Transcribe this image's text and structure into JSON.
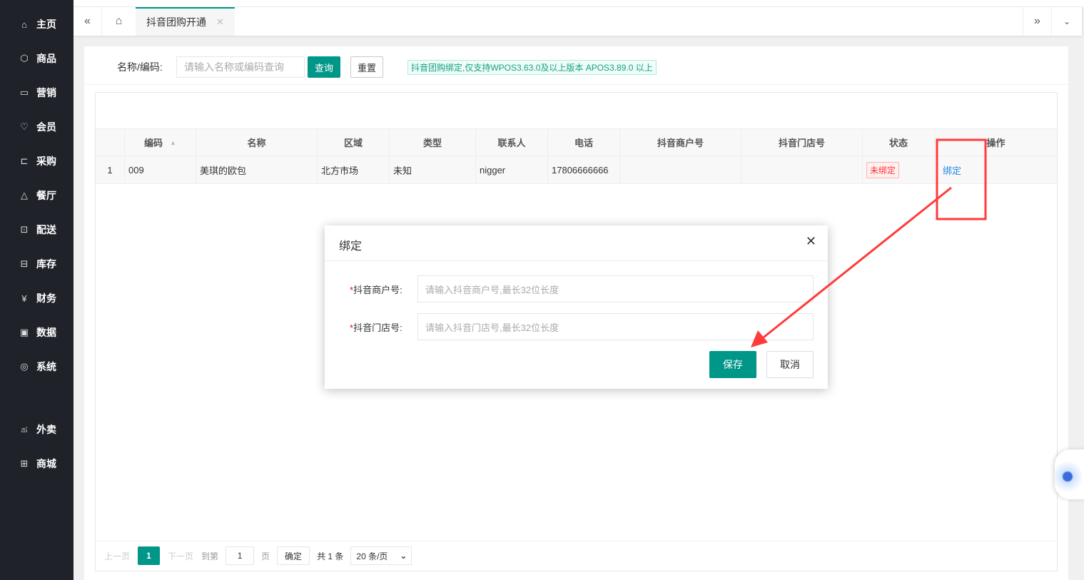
{
  "sidebar": {
    "items": [
      {
        "label": "主页",
        "icon": "home-icon"
      },
      {
        "label": "商品",
        "icon": "box-icon"
      },
      {
        "label": "营销",
        "icon": "chart-icon"
      },
      {
        "label": "会员",
        "icon": "diamond-icon"
      },
      {
        "label": "采购",
        "icon": "cart-icon"
      },
      {
        "label": "餐厅",
        "icon": "bell-icon"
      },
      {
        "label": "配送",
        "icon": "truck-icon"
      },
      {
        "label": "库存",
        "icon": "archive-icon"
      },
      {
        "label": "财务",
        "icon": "yen-icon"
      },
      {
        "label": "数据",
        "icon": "bar-chart-icon"
      },
      {
        "label": "系统",
        "icon": "settings-icon"
      },
      {
        "label": "外卖",
        "icon": "bike-icon"
      },
      {
        "label": "商城",
        "icon": "store-icon"
      }
    ]
  },
  "tabs": {
    "active": "抖音团购开通"
  },
  "search": {
    "label": "名称/编码:",
    "placeholder": "请输入名称或编码查询",
    "query": "查询",
    "reset": "重置",
    "notice": "抖音团购绑定,仅支持WPOS3.63.0及以上版本 APOS3.89.0 以上"
  },
  "table": {
    "headers": [
      "",
      "编码",
      "名称",
      "区域",
      "类型",
      "联系人",
      "电话",
      "抖音商户号",
      "抖音门店号",
      "状态",
      "操作"
    ],
    "rows": [
      {
        "index": "1",
        "code": "009",
        "name": "美琪的欧包",
        "region": "北方市场",
        "type": "未知",
        "contact": "nigger",
        "phone": "17806666666",
        "merchant": "",
        "store": "",
        "status": "未绑定",
        "action": "绑定"
      }
    ]
  },
  "pagination": {
    "prev": "上一页",
    "current": "1",
    "next": "下一页",
    "goto": "到第",
    "page_input": "1",
    "page_unit": "页",
    "confirm": "确定",
    "total": "共 1 条",
    "page_size": "20 条/页"
  },
  "dialog": {
    "title": "绑定",
    "fields": [
      {
        "label": "抖音商户号:",
        "placeholder": "请输入抖音商户号,最长32位长度"
      },
      {
        "label": "抖音门店号:",
        "placeholder": "请输入抖音门店号,最长32位长度"
      }
    ],
    "required_mark": "*",
    "save": "保存",
    "cancel": "取消"
  },
  "colors": {
    "primary": "#009688",
    "annotation": "#ff3b3b",
    "link": "#1e88e5"
  }
}
